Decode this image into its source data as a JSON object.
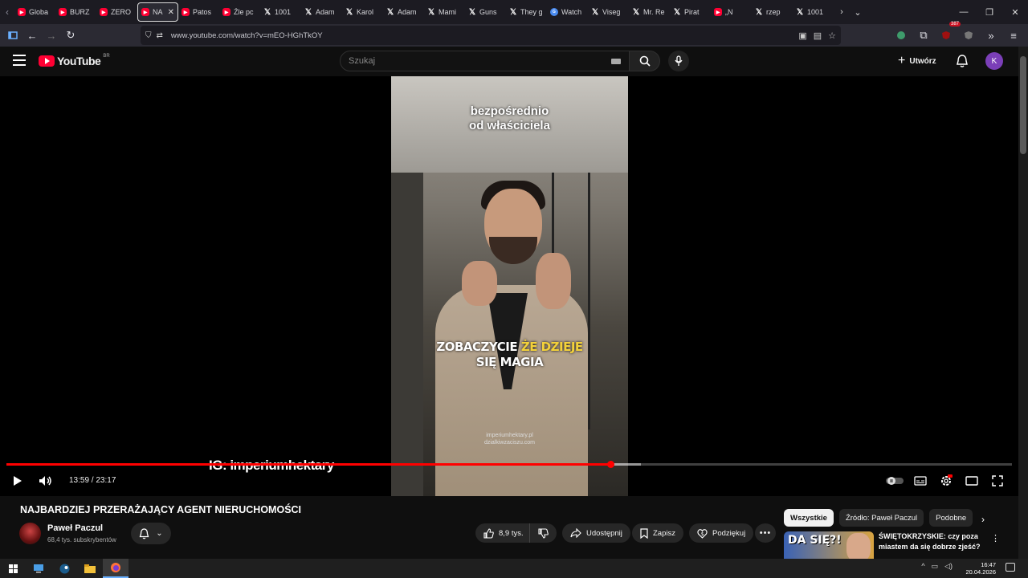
{
  "browser": {
    "tabs": [
      {
        "label": "Globa",
        "icon": "youtube-icon"
      },
      {
        "label": "BURZ",
        "icon": "youtube-icon"
      },
      {
        "label": "ZERO",
        "icon": "youtube-icon"
      },
      {
        "label": "NA",
        "icon": "youtube-icon",
        "active": true
      },
      {
        "label": "Patos",
        "icon": "youtube-icon"
      },
      {
        "label": "Źle pc",
        "icon": "youtube-icon"
      },
      {
        "label": "1001",
        "icon": "x-icon"
      },
      {
        "label": "Adam",
        "icon": "x-icon"
      },
      {
        "label": "Karol",
        "icon": "x-icon"
      },
      {
        "label": "Adam",
        "icon": "x-icon"
      },
      {
        "label": "Mami",
        "icon": "x-icon"
      },
      {
        "label": "Guns",
        "icon": "x-icon"
      },
      {
        "label": "They g",
        "icon": "x-icon"
      },
      {
        "label": "Watch",
        "icon": "grok-icon"
      },
      {
        "label": "Viseg",
        "icon": "x-icon"
      },
      {
        "label": "Mr. Re",
        "icon": "x-icon"
      },
      {
        "label": "Pirat",
        "icon": "x-icon"
      },
      {
        "label": "„N",
        "icon": "youtube-icon"
      },
      {
        "label": "rzep",
        "icon": "x-icon"
      },
      {
        "label": "1001",
        "icon": "x-icon"
      }
    ],
    "url": "www.youtube.com/watch?v=mEO-HGhTkOY",
    "extension_badge": "387"
  },
  "youtube": {
    "logo_text": "YouTube",
    "region": "BR",
    "search_placeholder": "Szukaj",
    "create_label": "Utwórz",
    "avatar_letter": "K"
  },
  "video": {
    "caption_top": "bezpośrednio\nod właściciela",
    "caption_mid_1": "ZOBACZYCIE",
    "caption_mid_2": "ŻE DZIEJE",
    "caption_mid_3": "SIĘ MAGIA",
    "watermark_1": "imperiumhektary.pl",
    "watermark_2": "dzialkiwzaciszu.com",
    "ig_overlay": "IG: imperiumhektary",
    "time": "13:59 / 23:17",
    "progress_played": 0.601,
    "progress_loaded": 0.631
  },
  "meta": {
    "title": "NAJBARDZIEJ PRZERAŻAJĄCY AGENT NIERUCHOMOŚCI",
    "channel": "Paweł Paczul",
    "subs": "68,4 tys. subskrybentów",
    "likes": "8,9 tys.",
    "share": "Udostępnij",
    "save": "Zapisz",
    "thanks": "Podziękuj"
  },
  "sidebar": {
    "chips": [
      "Wszystkie",
      "Źródło: Paweł Paczul",
      "Podobne"
    ],
    "rec_thumb_text": "DA SIĘ?!",
    "rec_title": "ŚWIĘTOKRZYSKIE: czy poza miastem da się dobrze zjeść?"
  },
  "taskbar": {
    "time": "16:47",
    "date": "20.04.2026"
  },
  "colors": {
    "accent": "#ff0033",
    "caption_yellow": "#f3d13a",
    "avatar": "#7b3fb8"
  }
}
